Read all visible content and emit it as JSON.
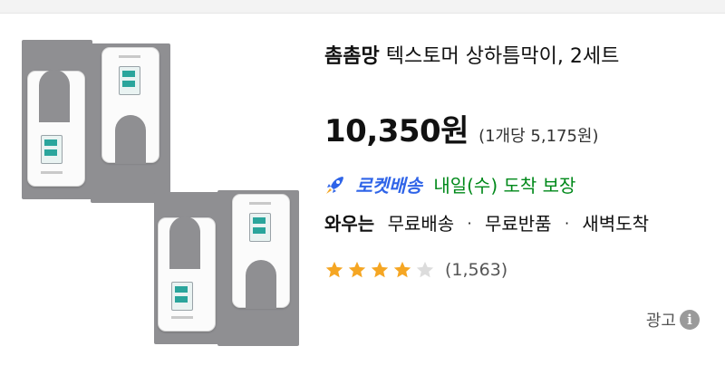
{
  "product": {
    "brand": "촘촘망",
    "title": "텍스토머 상하틈막이, 2세트",
    "price": "10,350원",
    "unit_price": "(1개당 5,175원)",
    "delivery": {
      "badge_icon": "rocket-icon",
      "badge_label": "로켓배송",
      "arrival": "내일(수) 도착 보장"
    },
    "wow": {
      "label": "와우는",
      "benefits": [
        "무료배송",
        "무료반품",
        "새벽도착"
      ],
      "separator": "·"
    },
    "rating": {
      "stars": 4,
      "max_stars": 5,
      "review_count": "(1,563)"
    },
    "ad": {
      "label": "광고",
      "icon": "info-icon",
      "icon_glyph": "i"
    }
  },
  "colors": {
    "rocket_blue": "#2f64e8",
    "arrival_green": "#00891a",
    "star_gold": "#f5a623",
    "star_empty": "#dcdcdc",
    "plate_gray": "#8f8f92"
  }
}
